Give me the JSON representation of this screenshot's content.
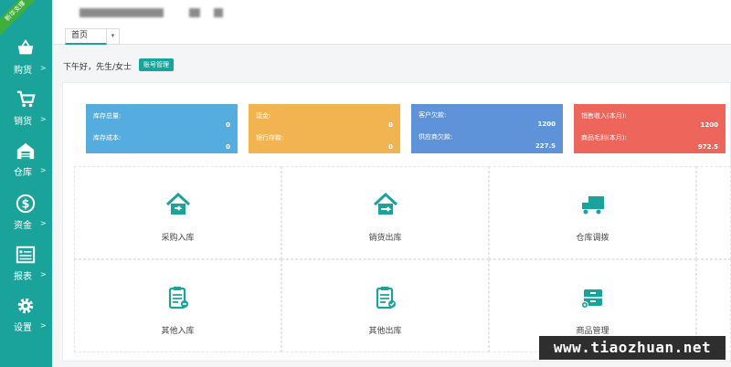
{
  "sidebar": {
    "ribbon": "新华支撑",
    "items": [
      {
        "label": "购货",
        "icon": "basket-icon"
      },
      {
        "label": "销货",
        "icon": "cart-icon"
      },
      {
        "label": "仓库",
        "icon": "warehouse-icon"
      },
      {
        "label": "资金",
        "icon": "dollar-icon"
      },
      {
        "label": "报表",
        "icon": "report-icon"
      },
      {
        "label": "设置",
        "icon": "gear-icon"
      }
    ],
    "arrow": ">"
  },
  "tabs": {
    "home": "首页",
    "dropdown": "▾"
  },
  "greeting": {
    "text": "下午好，先生/女士",
    "account_button": "账号管理"
  },
  "stats": [
    {
      "color": "#55acdf",
      "rows": [
        {
          "label": "库存总量:",
          "value": "0"
        },
        {
          "label": "库存成本:",
          "value": "0"
        }
      ]
    },
    {
      "color": "#f2b451",
      "rows": [
        {
          "label": "现金:",
          "value": "0"
        },
        {
          "label": "银行存款:",
          "value": "0"
        }
      ]
    },
    {
      "color": "#5e93d9",
      "rows": [
        {
          "label": "客户欠款:",
          "value": "1200"
        },
        {
          "label": "供应商欠款:",
          "value": "227.5"
        }
      ]
    },
    {
      "color": "#ee655c",
      "rows": [
        {
          "label": "销售收入(本月):",
          "value": "1200"
        },
        {
          "label": "商品毛利(本月):",
          "value": "972.5"
        }
      ]
    }
  ],
  "grid": [
    {
      "label": "采购入库",
      "icon": "house-in-icon"
    },
    {
      "label": "销货出库",
      "icon": "house-out-icon"
    },
    {
      "label": "仓库调拨",
      "icon": "truck-icon"
    },
    {
      "label": "其他入库",
      "icon": "clipboard-in-icon"
    },
    {
      "label": "其他出库",
      "icon": "clipboard-out-icon"
    },
    {
      "label": "商品管理",
      "icon": "cabinet-icon"
    }
  ],
  "accent": "#1aa39a",
  "watermark": "www.tiaozhuan.net"
}
